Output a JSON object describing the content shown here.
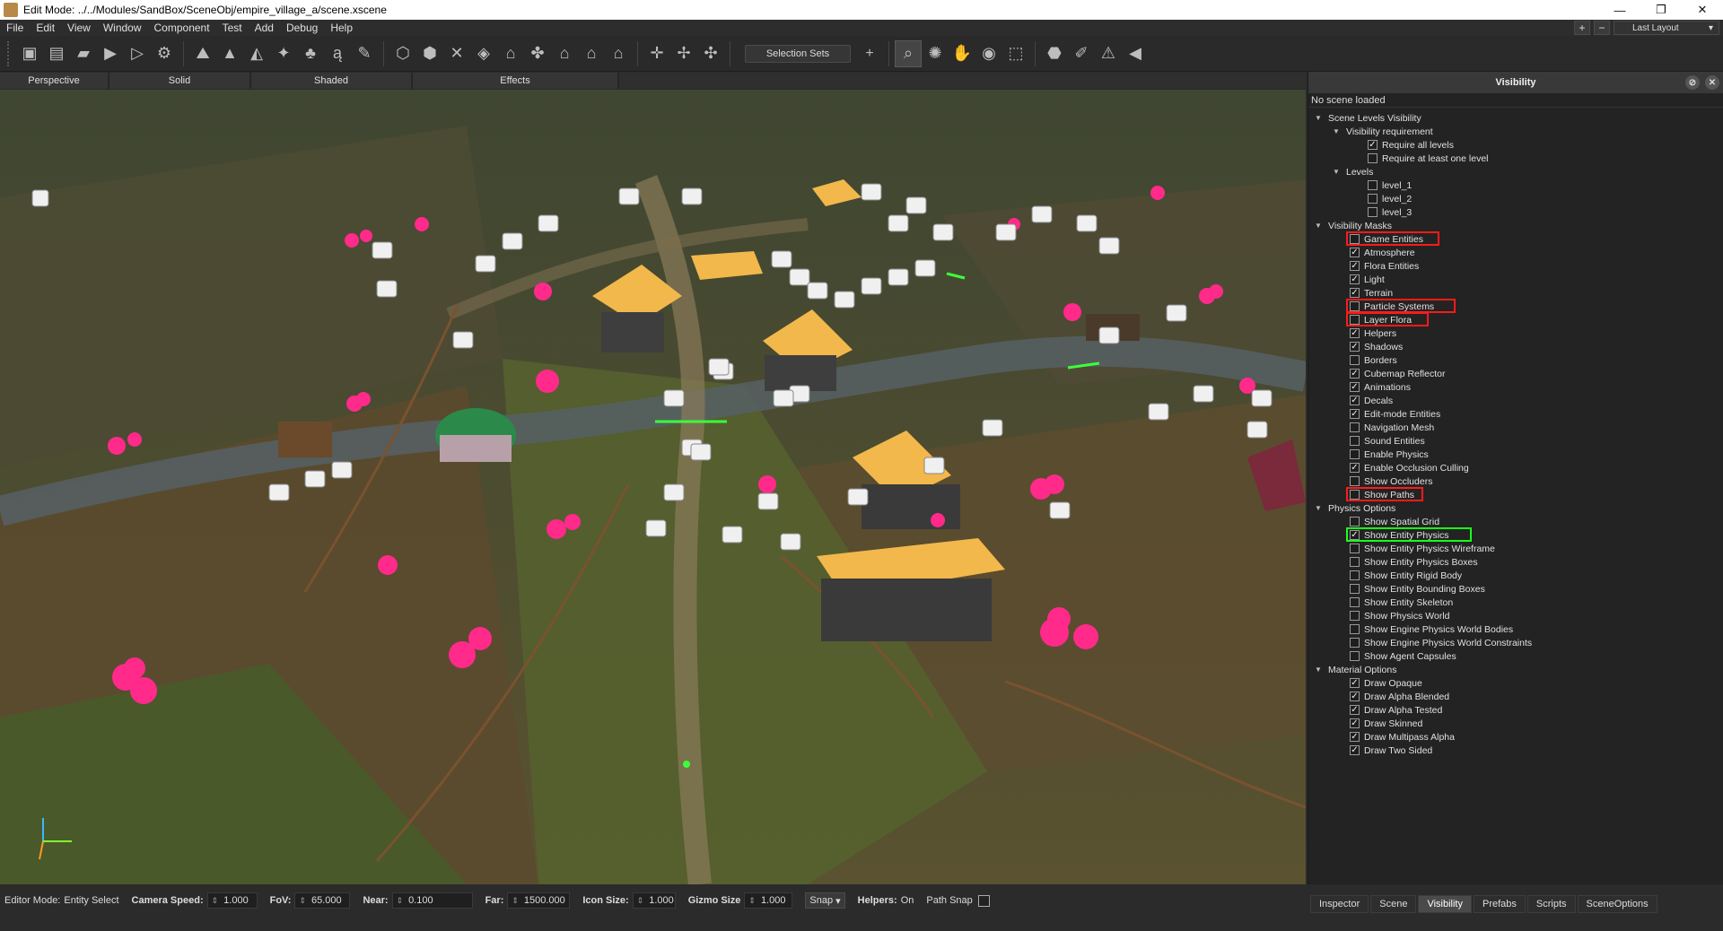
{
  "window": {
    "title": "Edit Mode: ../../Modules/SandBox/SceneObj/empire_village_a/scene.xscene",
    "minimize": "—",
    "maximize": "❐",
    "close": "✕"
  },
  "menu": [
    "File",
    "Edit",
    "View",
    "Window",
    "Component",
    "Test",
    "Add",
    "Debug",
    "Help"
  ],
  "layout": {
    "plus": "+",
    "minus": "−",
    "label": "Last Layout"
  },
  "toolbar": {
    "selection_sets": "Selection Sets",
    "add": "+"
  },
  "render_modes": [
    "Perspective",
    "Solid",
    "Shaded",
    "Effects"
  ],
  "statusbar": {
    "editor_mode_label": "Editor Mode:",
    "editor_mode_value": "Entity Select",
    "camera_speed_label": "Camera Speed:",
    "camera_speed": "1.000",
    "fov_label": "FoV:",
    "fov": "65.000",
    "near_label": "Near:",
    "near": "0.100",
    "far_label": "Far:",
    "far": "1500.000",
    "icon_size_label": "Icon Size:",
    "icon_size": "1.000",
    "gizmo_size_label": "Gizmo Size",
    "gizmo_size": "1.000",
    "snap": "Snap",
    "helpers_label": "Helpers:",
    "helpers_value": "On",
    "path_snap": "Path Snap"
  },
  "panel": {
    "title": "Visibility",
    "status": "No scene loaded",
    "tree": [
      {
        "label": "Scene Levels Visibility",
        "level": 0,
        "type": "section"
      },
      {
        "label": "Visibility requirement",
        "level": 1,
        "type": "section"
      },
      {
        "label": "Require all levels",
        "level": 2,
        "type": "check",
        "checked": true
      },
      {
        "label": "Require at least one level",
        "level": 2,
        "type": "check",
        "checked": false
      },
      {
        "label": "Levels",
        "level": 1,
        "type": "section"
      },
      {
        "label": "level_1",
        "level": 2,
        "type": "check",
        "checked": false
      },
      {
        "label": "level_2",
        "level": 2,
        "type": "check",
        "checked": false
      },
      {
        "label": "level_3",
        "level": 2,
        "type": "check",
        "checked": false
      },
      {
        "label": "Visibility Masks",
        "level": 0,
        "type": "section"
      },
      {
        "label": "Game Entities",
        "level": 1,
        "type": "check",
        "checked": false,
        "highlight": "red"
      },
      {
        "label": "Atmosphere",
        "level": 1,
        "type": "check",
        "checked": true
      },
      {
        "label": "Flora Entities",
        "level": 1,
        "type": "check",
        "checked": true
      },
      {
        "label": "Light",
        "level": 1,
        "type": "check",
        "checked": true
      },
      {
        "label": "Terrain",
        "level": 1,
        "type": "check",
        "checked": true
      },
      {
        "label": "Particle Systems",
        "level": 1,
        "type": "check",
        "checked": false,
        "highlight": "red"
      },
      {
        "label": "Layer Flora",
        "level": 1,
        "type": "check",
        "checked": false,
        "highlight": "red"
      },
      {
        "label": "Helpers",
        "level": 1,
        "type": "check",
        "checked": true
      },
      {
        "label": "Shadows",
        "level": 1,
        "type": "check",
        "checked": true
      },
      {
        "label": "Borders",
        "level": 1,
        "type": "check",
        "checked": false
      },
      {
        "label": "Cubemap Reflector",
        "level": 1,
        "type": "check",
        "checked": true
      },
      {
        "label": "Animations",
        "level": 1,
        "type": "check",
        "checked": true
      },
      {
        "label": "Decals",
        "level": 1,
        "type": "check",
        "checked": true
      },
      {
        "label": "Edit-mode Entities",
        "level": 1,
        "type": "check",
        "checked": true
      },
      {
        "label": "Navigation Mesh",
        "level": 1,
        "type": "check",
        "checked": false
      },
      {
        "label": "Sound Entities",
        "level": 1,
        "type": "check",
        "checked": false
      },
      {
        "label": "Enable Physics",
        "level": 1,
        "type": "check",
        "checked": false
      },
      {
        "label": "Enable Occlusion Culling",
        "level": 1,
        "type": "check",
        "checked": true
      },
      {
        "label": "Show Occluders",
        "level": 1,
        "type": "check",
        "checked": false
      },
      {
        "label": "Show Paths",
        "level": 1,
        "type": "check",
        "checked": false,
        "highlight": "red"
      },
      {
        "label": "Physics Options",
        "level": 0,
        "type": "section"
      },
      {
        "label": "Show Spatial Grid",
        "level": 1,
        "type": "check",
        "checked": false
      },
      {
        "label": "Show Entity Physics",
        "level": 1,
        "type": "check",
        "checked": true,
        "highlight": "green"
      },
      {
        "label": "Show Entity Physics Wireframe",
        "level": 1,
        "type": "check",
        "checked": false
      },
      {
        "label": "Show Entity Physics Boxes",
        "level": 1,
        "type": "check",
        "checked": false
      },
      {
        "label": "Show Entity Rigid Body",
        "level": 1,
        "type": "check",
        "checked": false
      },
      {
        "label": "Show Entity Bounding Boxes",
        "level": 1,
        "type": "check",
        "checked": false
      },
      {
        "label": "Show Entity Skeleton",
        "level": 1,
        "type": "check",
        "checked": false
      },
      {
        "label": "Show Physics World",
        "level": 1,
        "type": "check",
        "checked": false
      },
      {
        "label": "Show Engine Physics World Bodies",
        "level": 1,
        "type": "check",
        "checked": false
      },
      {
        "label": "Show Engine Physics World Constraints",
        "level": 1,
        "type": "check",
        "checked": false
      },
      {
        "label": "Show Agent Capsules",
        "level": 1,
        "type": "check",
        "checked": false
      },
      {
        "label": "Material Options",
        "level": 0,
        "type": "section"
      },
      {
        "label": "Draw Opaque",
        "level": 1,
        "type": "check",
        "checked": true
      },
      {
        "label": "Draw Alpha Blended",
        "level": 1,
        "type": "check",
        "checked": true
      },
      {
        "label": "Draw Alpha Tested",
        "level": 1,
        "type": "check",
        "checked": true
      },
      {
        "label": "Draw Skinned",
        "level": 1,
        "type": "check",
        "checked": true
      },
      {
        "label": "Draw Multipass Alpha",
        "level": 1,
        "type": "check",
        "checked": true
      },
      {
        "label": "Draw Two Sided",
        "level": 1,
        "type": "check",
        "checked": true
      }
    ]
  },
  "bottom_tabs": [
    "Inspector",
    "Scene",
    "Visibility",
    "Prefabs",
    "Scripts",
    "SceneOptions"
  ],
  "active_tab": "Visibility"
}
